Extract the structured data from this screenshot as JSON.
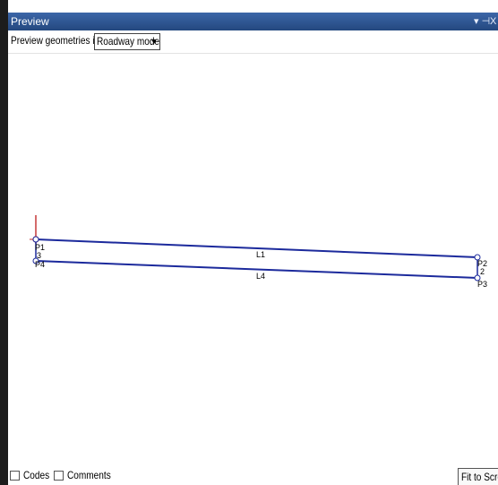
{
  "window": {
    "title": "Preview",
    "pin_label": "▾ ⊣",
    "close_label": "X"
  },
  "toolbar": {
    "label": "Preview geometries in",
    "mode_value": "Roadway mode"
  },
  "canvas": {
    "point_labels": {
      "p1": "P1",
      "p2": "P2",
      "p3": "P3",
      "p4": "P4"
    },
    "line_labels": {
      "l1": "L1",
      "l2": "2",
      "l3": "3",
      "l4": "L4"
    }
  },
  "footer": {
    "codes_label": "Codes",
    "comments_label": "Comments",
    "fit_label": "Fit to Screen"
  },
  "colors": {
    "title_bar": "#2c5391",
    "line": "#1c2a9c",
    "origin_marker": "#c22a2a"
  },
  "icons": [
    "pin-icon",
    "close-icon",
    "chevron-down-icon",
    "origin-marker-icon"
  ]
}
